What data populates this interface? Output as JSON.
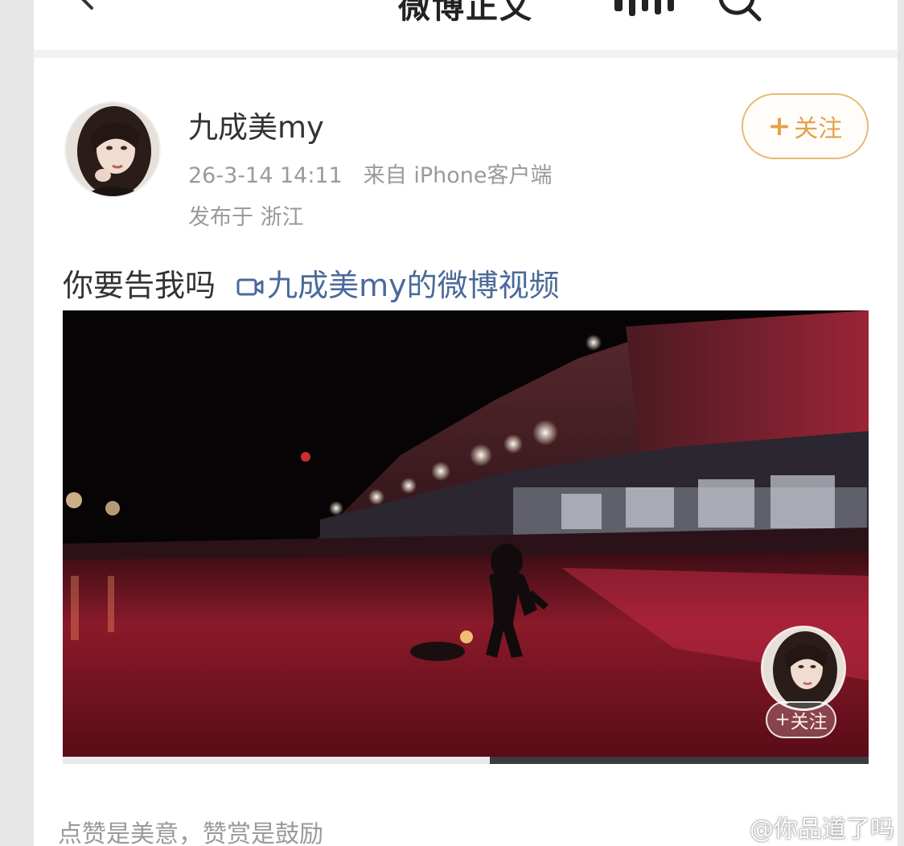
{
  "nav": {
    "title": "微博正文",
    "back_icon": "chevron-left-icon",
    "icons": [
      "waveform-icon",
      "search-icon",
      "more-icon"
    ]
  },
  "post": {
    "username": "九成美my",
    "date": "26-3-14 14:11",
    "source": "来自 iPhone客户端",
    "location": "发布于 浙江",
    "follow_label": "关注",
    "text": "你要告我吗",
    "video_link": "九成美my的微博视频"
  },
  "video": {
    "follow_label": "关注",
    "progress": 0.53
  },
  "footer": {
    "caption": "点赞是美意，赞赏是鼓励"
  },
  "watermark": {
    "text": "@你品道了吗"
  },
  "colors": {
    "follow_accent": "#e6a04a",
    "link_blue": "#4a6a99",
    "meta_gray": "#9a9a9a"
  }
}
